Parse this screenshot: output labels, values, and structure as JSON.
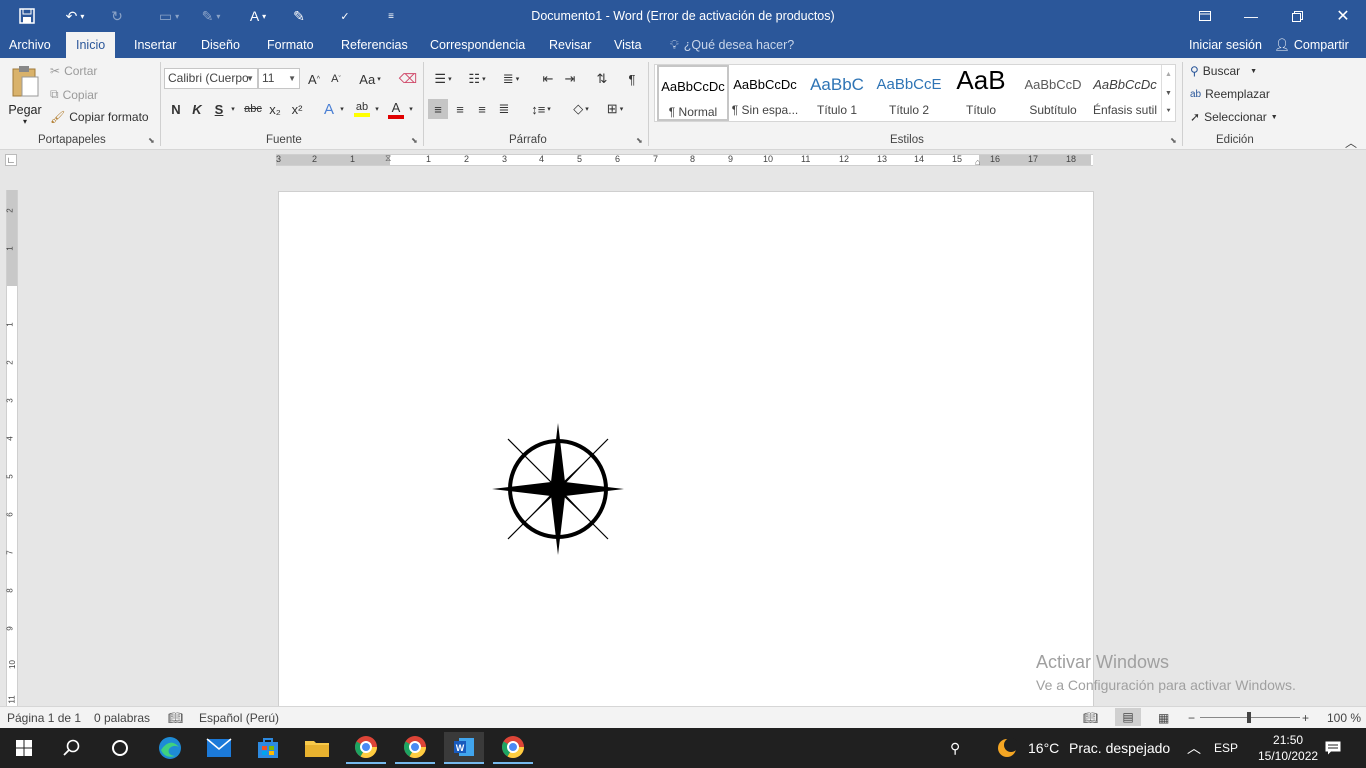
{
  "title": "Documento1 - Word (Error de activación de productos)",
  "tabs": [
    "Archivo",
    "Inicio",
    "Insertar",
    "Diseño",
    "Formato",
    "Referencias",
    "Correspondencia",
    "Revisar",
    "Vista"
  ],
  "tell_me": "¿Qué desea hacer?",
  "sign_in": "Iniciar sesión",
  "share": "Compartir",
  "clipboard": {
    "paste": "Pegar",
    "cut": "Cortar",
    "copy": "Copiar",
    "format_painter": "Copiar formato",
    "group": "Portapapeles"
  },
  "font": {
    "name": "Calibri (Cuerpo",
    "size": "11",
    "group": "Fuente",
    "bold": "N",
    "italic": "K",
    "underline": "S",
    "strike": "abc",
    "sub": "x₂",
    "sup": "x²",
    "case": "Aa"
  },
  "paragraph": {
    "group": "Párrafo"
  },
  "styles": {
    "group": "Estilos",
    "items": [
      {
        "preview": "AaBbCcDc",
        "label": "¶ Normal"
      },
      {
        "preview": "AaBbCcDc",
        "label": "¶ Sin espa..."
      },
      {
        "preview": "AaBbC",
        "label": "Título 1"
      },
      {
        "preview": "AaBbCcE",
        "label": "Título 2"
      },
      {
        "preview": "AaB",
        "label": "Título"
      },
      {
        "preview": "AaBbCcD",
        "label": "Subtítulo"
      },
      {
        "preview": "AaBbCcDc",
        "label": "Énfasis sutil"
      }
    ]
  },
  "editing": {
    "group": "Edición",
    "find": "Buscar",
    "replace": "Reemplazar",
    "select": "Seleccionar"
  },
  "hruler_numbers": [
    "3",
    "2",
    "1",
    "1",
    "2",
    "3",
    "4",
    "5",
    "6",
    "7",
    "8",
    "9",
    "10",
    "11",
    "12",
    "13",
    "14",
    "15",
    "16",
    "17",
    "18"
  ],
  "vruler_numbers": [
    "2",
    "1",
    "1",
    "2",
    "3",
    "4",
    "5",
    "6",
    "7",
    "8",
    "9",
    "10",
    "11"
  ],
  "activation": {
    "line1": "Activar Windows",
    "line2": "Ve a Configuración para activar Windows."
  },
  "status": {
    "page": "Página 1 de 1",
    "words": "0 palabras",
    "language": "Español (Perú)",
    "zoom": "100 %"
  },
  "taskbar": {
    "temperature": "16°C",
    "weather": "Prac. despejado",
    "lang": "ESP",
    "time": "21:50",
    "date": "15/10/2022"
  },
  "colors": {
    "accent": "#2b579a",
    "highlight": "#ffff00",
    "font_color": "#e00000"
  }
}
